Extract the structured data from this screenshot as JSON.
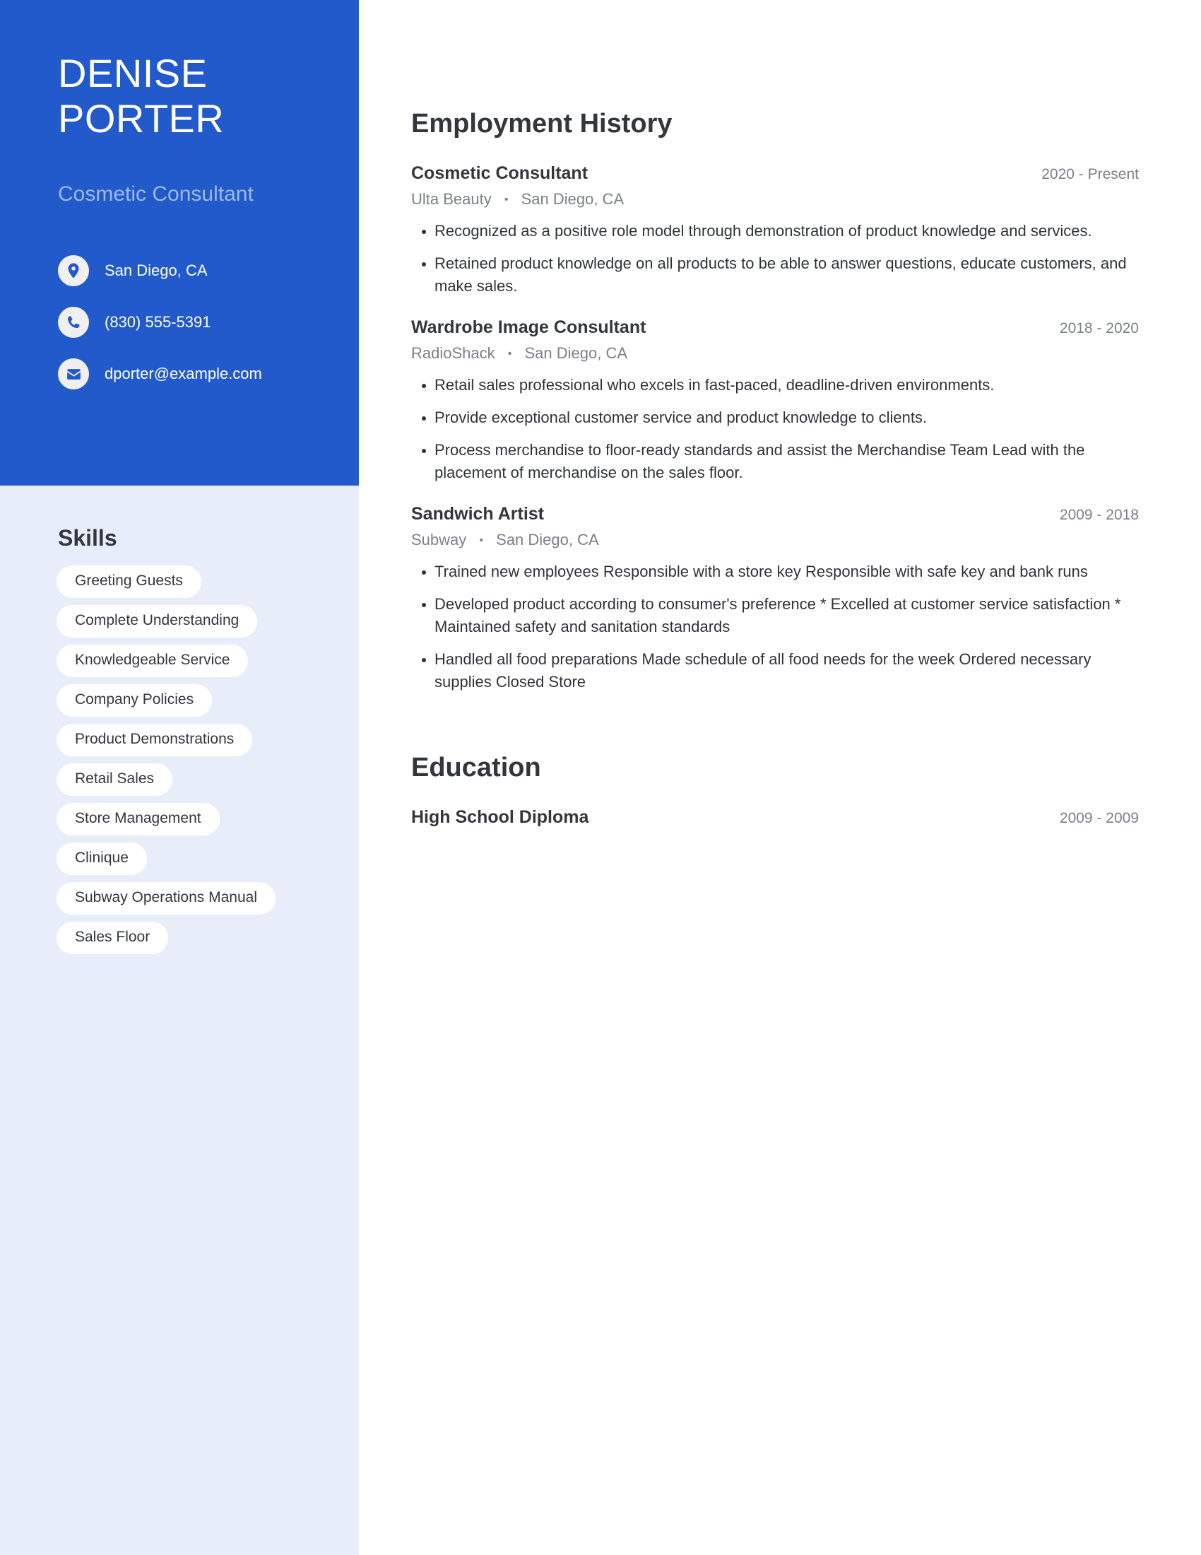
{
  "profile": {
    "first_name": "DENISE",
    "last_name": "PORTER",
    "headline": "Cosmetic Consultant"
  },
  "contact": [
    {
      "icon": "location-pin-icon",
      "text": "San Diego, CA"
    },
    {
      "icon": "phone-icon",
      "text": "(830) 555-5391"
    },
    {
      "icon": "email-icon",
      "text": "dporter@example.com"
    }
  ],
  "skills": {
    "title": "Skills",
    "items": [
      "Greeting Guests",
      "Complete Understanding",
      "Knowledgeable Service",
      "Company Policies",
      "Product Demonstrations",
      "Retail Sales",
      "Store Management",
      "Clinique",
      "Subway Operations Manual",
      "Sales Floor"
    ]
  },
  "employment": {
    "title": "Employment History",
    "entries": [
      {
        "role": "Cosmetic Consultant",
        "date": "2020 - Present",
        "company": "Ulta Beauty",
        "location": "San Diego, CA",
        "bullets": [
          "Recognized as a positive role model through demonstration of product knowledge and services.",
          "Retained product knowledge on all products to be able to answer questions, educate customers, and make sales."
        ]
      },
      {
        "role": "Wardrobe Image Consultant",
        "date": "2018 - 2020",
        "company": "RadioShack",
        "location": "San Diego, CA",
        "bullets": [
          "Retail sales professional who excels in fast-paced, deadline-driven environments.",
          "Provide exceptional customer service and product knowledge to clients.",
          "Process merchandise to floor-ready standards and assist the Merchandise Team Lead with the placement of merchandise on the sales floor."
        ]
      },
      {
        "role": "Sandwich Artist",
        "date": "2009 - 2018",
        "company": "Subway",
        "location": "San Diego, CA",
        "bullets": [
          "Trained new employees Responsible with a store key Responsible with safe key and bank runs",
          "Developed product according to consumer's preference * Excelled at customer service satisfaction * Maintained safety and sanitation standards",
          "Handled all food preparations Made schedule of all food needs for the week Ordered necessary supplies Closed Store"
        ]
      }
    ]
  },
  "education": {
    "title": "Education",
    "entries": [
      {
        "degree": "High School Diploma",
        "date": "2009 - 2009"
      }
    ]
  },
  "colors": {
    "accent_blue": "#2259cb",
    "sidebar_light": "#e8eef9",
    "heading_dark": "#33373d",
    "muted_gray": "#7b7f86",
    "subtitle_blue": "#9db8e8",
    "pill_white": "#ffffff"
  },
  "separator": "•"
}
